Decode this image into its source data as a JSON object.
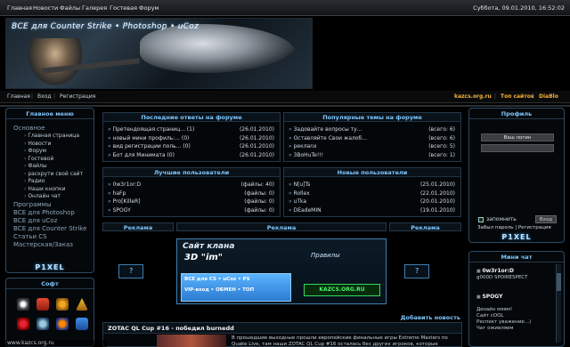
{
  "topnav": {
    "items": [
      "Главная",
      "Новости",
      "Файлы",
      "Галерея",
      "Гостевая",
      "Форум"
    ],
    "datetime": "Суббота, 09.01.2010, 16:52:02"
  },
  "banner": {
    "title": "ВСЕ для Counter Strike • Photoshop • uCoz"
  },
  "subnav": {
    "left": [
      "Главная",
      "Вход",
      "Регистрация"
    ],
    "right": [
      "kazcs.org.ru",
      "Топ сайтов",
      "DiaBlo"
    ]
  },
  "leftmenu": {
    "title": "Главное меню",
    "items": [
      {
        "label": "Основное",
        "type": "section"
      },
      {
        "label": "Главная страница",
        "type": "sub"
      },
      {
        "label": "Новости",
        "type": "sub"
      },
      {
        "label": "Форум",
        "type": "sub"
      },
      {
        "label": "Гостевой",
        "type": "sub"
      },
      {
        "label": "Файлы",
        "type": "sub"
      },
      {
        "label": "раскрути свой сайт",
        "type": "sub"
      },
      {
        "label": "Радио",
        "type": "sub"
      },
      {
        "label": "Наши кнопки",
        "type": "sub"
      },
      {
        "label": "Онлайн чат",
        "type": "sub"
      },
      {
        "label": "Программы",
        "type": "section"
      },
      {
        "label": "ВСЕ для Photoshop",
        "type": "section"
      },
      {
        "label": "ВСЕ для uCoz",
        "type": "section"
      },
      {
        "label": "ВСЕ для Counter Strike",
        "type": "section"
      },
      {
        "label": "Статьи CS",
        "type": "section"
      },
      {
        "label": "Мастерская/Заказ",
        "type": "section"
      }
    ],
    "logo": "P1XEL"
  },
  "soft": {
    "title": "Софт"
  },
  "lastposts": {
    "title": "Последние ответы на форуме",
    "rows": [
      {
        "t": "Претендоящая страниц... (1)",
        "d": "(26.01.2010)"
      },
      {
        "t": "новый мини профиль:... (0)",
        "d": "(26.01.2010)"
      },
      {
        "t": "вид регистрации поль... (0)",
        "d": "(26.01.2010)"
      },
      {
        "t": "Бот для Минимата (0)",
        "d": "(26.01.2010)"
      }
    ]
  },
  "populartopics": {
    "title": "Популярные темы на форуме",
    "rows": [
      {
        "t": "Задовайте вопросы ту...",
        "d": "(всего: 6)"
      },
      {
        "t": "Оставляйте Свои жалоб...",
        "d": "(всего: 6)"
      },
      {
        "t": "реклаnx",
        "d": "(всего: 5)"
      },
      {
        "t": "3BoHuTe!!!",
        "d": "(всего: 1)"
      }
    ]
  },
  "bestusers": {
    "title": "Лучшие пользователи",
    "rows": [
      {
        "t": "0w3r1or:D",
        "d": "(файлы: 40)"
      },
      {
        "t": "haFp",
        "d": "(файлы: 0)"
      },
      {
        "t": "Pro[KilleR]",
        "d": "(файлы: 0)"
      },
      {
        "t": "SPOGY",
        "d": "(файлы: 0)"
      }
    ]
  },
  "newusers": {
    "title": "Новые пользователи",
    "rows": [
      {
        "t": "N[u]Ts",
        "d": "(25.01.2010)"
      },
      {
        "t": "Rollex",
        "d": "(22.01.2010)"
      },
      {
        "t": "uTka",
        "d": "(20.01.2010)"
      },
      {
        "t": "DEadeMIN",
        "d": "(19.01.2010)"
      }
    ]
  },
  "ads": {
    "left": "Реклама",
    "center": "Реклама",
    "right": "Реклама"
  },
  "adbanner": {
    "line1": "Сайт клана",
    "line2": "3D \"im\"",
    "line3": "ВСЕ для CS • uCoz • PS",
    "line4": "VIP-вход • ОБМЕН • ТОП",
    "brand": "KAZCS.ORG.RU",
    "tag": "Правилы"
  },
  "news": {
    "add": "Добавить новость",
    "title": "ZOTAC QL Cup #16 - победил burnedd",
    "text": "В прошедшие выходные прошли европейские финальные игры Extreme Masters по Quake Live, там наши ZOTAC QL Cup #16 осталась без других игроков, которые"
  },
  "profile": {
    "title": "Профиль",
    "login_placeholder": "Ваш логин",
    "password_placeholder": "",
    "remember": "запомнить",
    "login_button": "Вход",
    "forgot": "Забыл пароль | Регистрация",
    "logo": "P1XEL"
  },
  "minichat": {
    "title": "Мини чат",
    "messages": [
      {
        "name": "0w3r1or:D",
        "text": "g000D SPOIRESPECT"
      },
      {
        "name": "SPOGY",
        "text": "Дизайн мяям!\nСайт cOOL\nРеспект уважение...)\nЧат оживляем"
      }
    ]
  },
  "status": {
    "url": "www.kazcs.org.ru"
  }
}
